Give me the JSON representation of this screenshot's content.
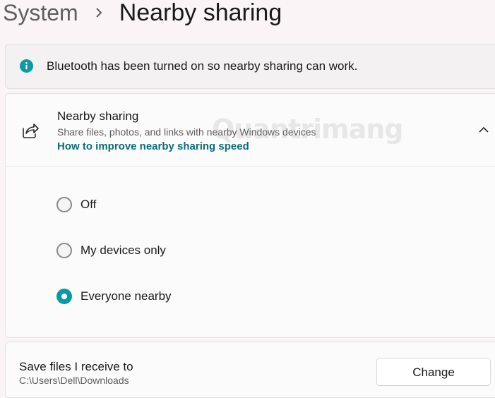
{
  "breadcrumb": {
    "parent": "System",
    "separator_icon": "chevron-right-icon",
    "current": "Nearby sharing"
  },
  "info_bar": {
    "icon": "info-icon",
    "accent_color": "#0e9ba4",
    "text": "Bluetooth has been turned on so nearby sharing can work."
  },
  "nearby_sharing": {
    "icon": "share-icon",
    "title": "Nearby sharing",
    "description": "Share files, photos, and links with nearby Windows devices",
    "link": "How to improve nearby sharing speed",
    "expanded": true,
    "options": [
      {
        "label": "Off",
        "selected": false
      },
      {
        "label": "My devices only",
        "selected": false
      },
      {
        "label": "Everyone nearby",
        "selected": true
      }
    ]
  },
  "save_location": {
    "title": "Save files I receive to",
    "path": "C:\\Users\\Dell\\Downloads",
    "button": "Change"
  },
  "watermark": {
    "text": "Quantrimang"
  },
  "colors": {
    "accent": "#0b9aa3",
    "link": "#0a6f7a",
    "background": "#fbf4f6"
  }
}
